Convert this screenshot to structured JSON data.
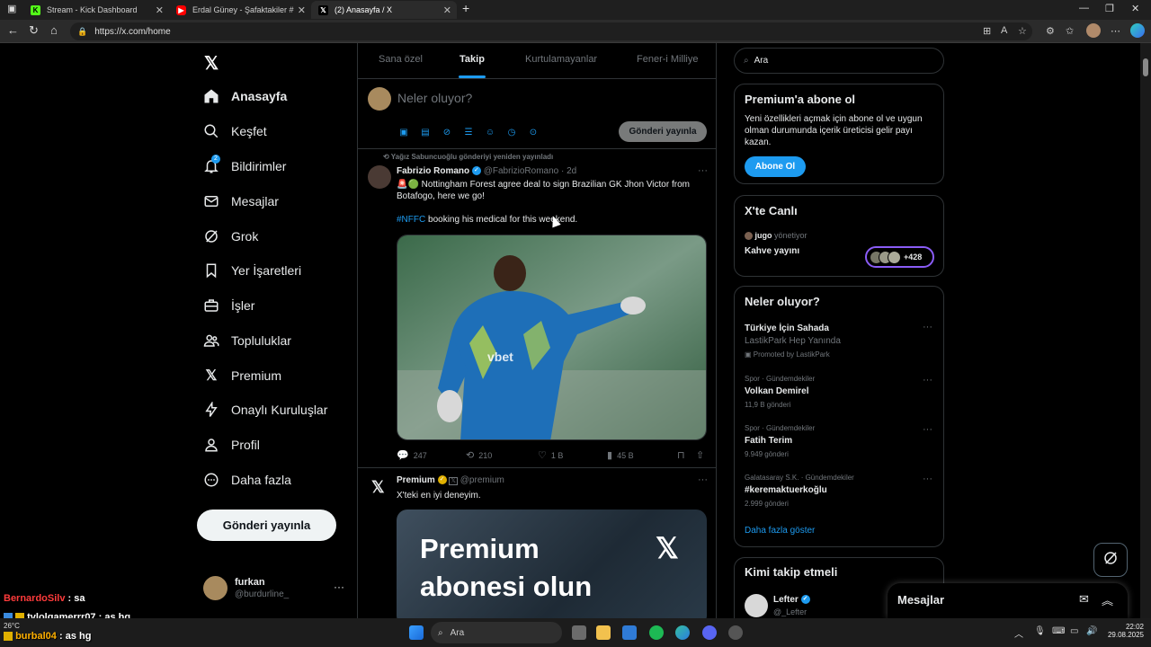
{
  "browser": {
    "tabs": [
      {
        "title": "Stream - Kick Dashboard",
        "favicon": "kick-icon",
        "active": false
      },
      {
        "title": "Erdal Güney - Şafaktakiler #",
        "favicon": "youtube-icon",
        "active": false
      },
      {
        "title": "(2) Anasayfa / X",
        "favicon": "x-icon",
        "active": true
      }
    ],
    "url": "https://x.com/home"
  },
  "nav": {
    "items": [
      {
        "label": "Anasayfa",
        "icon": "home-icon"
      },
      {
        "label": "Keşfet",
        "icon": "search-icon"
      },
      {
        "label": "Bildirimler",
        "icon": "bell-icon",
        "badge": "2"
      },
      {
        "label": "Mesajlar",
        "icon": "mail-icon"
      },
      {
        "label": "Grok",
        "icon": "grok-icon"
      },
      {
        "label": "Yer İşaretleri",
        "icon": "bookmark-icon"
      },
      {
        "label": "İşler",
        "icon": "briefcase-icon"
      },
      {
        "label": "Topluluklar",
        "icon": "people-icon"
      },
      {
        "label": "Premium",
        "icon": "x-icon"
      },
      {
        "label": "Onaylı Kuruluşlar",
        "icon": "lightning-icon"
      },
      {
        "label": "Profil",
        "icon": "person-icon"
      },
      {
        "label": "Daha fazla",
        "icon": "more-circle-icon"
      }
    ],
    "post_button": "Gönderi yayınla",
    "account": {
      "name": "furkan",
      "handle": "@burdurline_"
    }
  },
  "feed": {
    "tabs": [
      "Sana özel",
      "Takip",
      "Kurtulamayanlar",
      "Fener-i Milliye"
    ],
    "active_tab": "Takip",
    "compose": {
      "placeholder": "Neler oluyor?",
      "post_button": "Gönderi yayınla"
    },
    "tweet1": {
      "repost_note": "Yağız Sabuncuoğlu gönderiyi yeniden yayınladı",
      "author": "Fabrizio Romano",
      "handle": "@FabrizioRomano",
      "time": "· 2d",
      "line1": "🚨🟢 Nottingham Forest agree deal to sign Brazilian GK Jhon Victor from",
      "line2": "Botafogo, here we go!",
      "hashtag": "#NFFC",
      "line3": " booking his medical for this weekend.",
      "replies": "247",
      "reposts": "210",
      "likes": "1 B",
      "views": "45 B"
    },
    "tweet2": {
      "author": "Premium",
      "handle": "@premium",
      "text": "X'teki en iyi deneyim.",
      "banner_line1": "Premium",
      "banner_line2": "abonesi olun"
    }
  },
  "right": {
    "search_placeholder": "Ara",
    "premium": {
      "title": "Premium'a abone ol",
      "line1": "Yeni özellikleri açmak için abone ol ve uygun",
      "line2": "olman durumunda içerik üreticisi gelir payı",
      "line3": "kazan.",
      "button": "Abone Ol"
    },
    "live": {
      "title": "X'te Canlı",
      "host": "jugo",
      "host_suffix": "yönetiyor",
      "space": "Kahve yayını",
      "listeners": "+428"
    },
    "trends": {
      "title": "Neler oluyor?",
      "items": [
        {
          "meta": "",
          "name": "Türkiye İçin Sahada",
          "sub": "LastikPark Hep Yanında",
          "extra": "Promoted by LastikPark"
        },
        {
          "meta": "Spor · Gündemdekiler",
          "name": "Volkan Demirel",
          "sub": "11,9 B gönderi"
        },
        {
          "meta": "Spor · Gündemdekiler",
          "name": "Fatih Terim",
          "sub": "9.949 gönderi"
        },
        {
          "meta": "Galatasaray S.K. · Gündemdekiler",
          "name": "#keremaktuerkoğlu",
          "sub": "2.999 gönderi"
        }
      ],
      "show_more": "Daha fazla göster"
    },
    "who_to_follow": {
      "title": "Kimi takip etmeli",
      "name": "Lefter",
      "handle": "@_Lefter"
    },
    "messages_drawer": "Mesajlar"
  },
  "chat_overlay": [
    {
      "user": "BernardoSilv",
      "msg": " : sa",
      "color": "#ff3b3b"
    },
    {
      "user": "tvlolgamerrr07",
      "msg": " : as hg",
      "color": "#ffffff"
    },
    {
      "user": "burbal04",
      "msg": " : as hg",
      "color": "#ffb000"
    }
  ],
  "taskbar": {
    "search": "Ara",
    "weather": "26°C",
    "time": "22:02",
    "date": "29.08.2025"
  },
  "colors": {
    "accent": "#1d9bf0",
    "border": "#2f3336",
    "muted": "#71767b"
  }
}
